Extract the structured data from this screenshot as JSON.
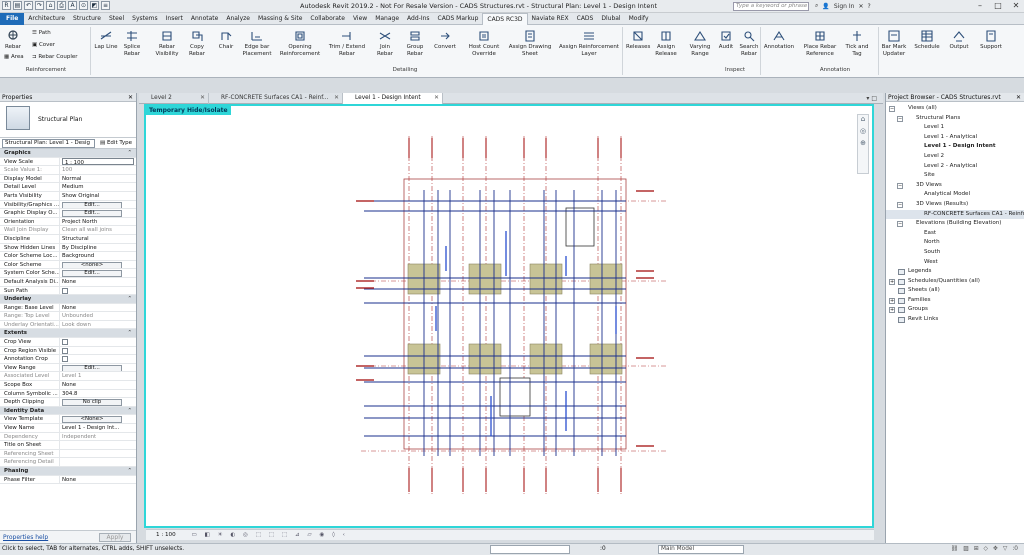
{
  "title_bar": {
    "title": "Autodesk Revit 2019.2 - Not For Resale Version - CADS Structures.rvt - Structural Plan: Level 1 - Design Intent",
    "search_placeholder": "Type a keyword or phrase",
    "sign_in": "Sign In",
    "qat_icons": [
      "R",
      "▤",
      "↶",
      "↷",
      "⌂",
      "⎙",
      "A",
      "⊙",
      "◩",
      "≡"
    ]
  },
  "ribbon_tabs": [
    "File",
    "Architecture",
    "Structure",
    "Steel",
    "Systems",
    "Insert",
    "Annotate",
    "Analyze",
    "Massing & Site",
    "Collaborate",
    "View",
    "Manage",
    "Add-Ins",
    "CADS Markup",
    "CADS RC3D",
    "Naviate REX",
    "CADS",
    "Dlubal",
    "Modify"
  ],
  "active_tab": "CADS RC3D",
  "ribbon": {
    "reinforcement": {
      "panel": "Reinforcement",
      "rebar": "Rebar",
      "area": "Area",
      "path": "Path",
      "cover": "Cover",
      "coupler": "Rebar Coupler"
    },
    "tools": {
      "lap_line": "Lap Line",
      "splice_rebar": "Splice Rebar",
      "rebar_visibility": "Rebar Visibility",
      "copy_rebar": "Copy Rebar",
      "chair": "Chair",
      "edge_bar": "Edge bar Placement",
      "opening": "Opening Reinforcement",
      "trim_extend": "Trim / Extend Rebar",
      "join_rebar": "Join Rebar",
      "group_rebar": "Group Rebar",
      "convert": "Convert",
      "host_count": "Host Count Override",
      "assign_sheet": "Assign Drawing Sheet",
      "assign_layer": "Assign Reinforcement Layer",
      "releases": "Releases",
      "assign_release": "Assign Release",
      "varying_range": "Varying Range",
      "audit": "Audit",
      "search_rebar": "Search Rebar",
      "annotation": "Annotation",
      "place_ref": "Place Rebar Reference",
      "tick_tag": "Tick and Tag",
      "bar_mark": "Bar Mark Updater",
      "schedule": "Schedule",
      "output": "Output",
      "support": "Support"
    },
    "panels": {
      "detailing": "Detailing",
      "inspect": "Inspect",
      "annotation": "Annotation"
    }
  },
  "properties": {
    "header": "Properties",
    "type_name": "Structural Plan",
    "instance_selector": "Structural Plan: Level 1 - Desig",
    "edit_type": "Edit Type",
    "rows": [
      {
        "kind": "sec",
        "k": "Graphics"
      },
      {
        "k": "View Scale",
        "v": "1 : 100",
        "box": true
      },
      {
        "k": "Scale Value    1:",
        "v": "100",
        "grey": true
      },
      {
        "k": "Display Model",
        "v": "Normal"
      },
      {
        "k": "Detail Level",
        "v": "Medium"
      },
      {
        "k": "Parts Visibility",
        "v": "Show Original"
      },
      {
        "k": "Visibility/Graphics ...",
        "v": "Edit...",
        "btn": true
      },
      {
        "k": "Graphic Display O...",
        "v": "Edit...",
        "btn": true
      },
      {
        "k": "Orientation",
        "v": "Project North"
      },
      {
        "k": "Wall Join Display",
        "v": "Clean all wall joins",
        "grey": true
      },
      {
        "k": "Discipline",
        "v": "Structural"
      },
      {
        "k": "Show Hidden Lines",
        "v": "By Discipline"
      },
      {
        "k": "Color Scheme Loc...",
        "v": "Background"
      },
      {
        "k": "Color Scheme",
        "v": "<none>",
        "btn": true
      },
      {
        "k": "System Color Sche...",
        "v": "Edit...",
        "btn": true
      },
      {
        "k": "Default Analysis Di...",
        "v": "None"
      },
      {
        "k": "Sun Path",
        "v": "",
        "cb": true
      },
      {
        "kind": "sec",
        "k": "Underlay"
      },
      {
        "k": "Range: Base Level",
        "v": "None"
      },
      {
        "k": "Range: Top Level",
        "v": "Unbounded",
        "grey": true
      },
      {
        "k": "Underlay Orientati...",
        "v": "Look down",
        "grey": true
      },
      {
        "kind": "sec",
        "k": "Extents"
      },
      {
        "k": "Crop View",
        "v": "",
        "cb": true
      },
      {
        "k": "Crop Region Visible",
        "v": "",
        "cb": true
      },
      {
        "k": "Annotation Crop",
        "v": "",
        "cb": true
      },
      {
        "k": "View Range",
        "v": "Edit...",
        "btn": true
      },
      {
        "k": "Associated Level",
        "v": "Level 1",
        "grey": true
      },
      {
        "k": "Scope Box",
        "v": "None"
      },
      {
        "k": "Column Symbolic ...",
        "v": "304.8"
      },
      {
        "k": "Depth Clipping",
        "v": "No clip",
        "btn": true
      },
      {
        "kind": "sec",
        "k": "Identity Data"
      },
      {
        "k": "View Template",
        "v": "<None>",
        "btn": true
      },
      {
        "k": "View Name",
        "v": "Level 1 - Design Int..."
      },
      {
        "k": "Dependency",
        "v": "Independent",
        "grey": true
      },
      {
        "k": "Title on Sheet",
        "v": ""
      },
      {
        "k": "Referencing Sheet",
        "v": "",
        "grey": true
      },
      {
        "k": "Referencing Detail",
        "v": "",
        "grey": true
      },
      {
        "kind": "sec",
        "k": "Phasing"
      },
      {
        "k": "Phase Filter",
        "v": "None"
      }
    ],
    "help": "Properties help",
    "apply": "Apply"
  },
  "view_tabs": [
    "Level 2",
    "RF-CONCRETE Surfaces CA1 - Reinf...",
    "Level 1 - Design Intent"
  ],
  "canvas": {
    "badge": "Temporary Hide/Isolate"
  },
  "view_control": {
    "scale": "1 : 100"
  },
  "browser": {
    "header": "Project Browser - CADS Structures.rvt",
    "items": [
      {
        "t": "Views (all)",
        "d": 0,
        "ex": "−"
      },
      {
        "t": "Structural Plans",
        "d": 1,
        "ex": "−"
      },
      {
        "t": "Level 1",
        "d": 3
      },
      {
        "t": "Level 1 - Analytical",
        "d": 3
      },
      {
        "t": "Level 1 - Design Intent",
        "d": 3,
        "bold": true
      },
      {
        "t": "Level 2",
        "d": 3
      },
      {
        "t": "Level 2 - Analytical",
        "d": 3
      },
      {
        "t": "Site",
        "d": 3
      },
      {
        "t": "3D Views",
        "d": 1,
        "ex": "−"
      },
      {
        "t": "Analytical Model",
        "d": 3
      },
      {
        "t": "3D Views (Results)",
        "d": 1,
        "ex": "−"
      },
      {
        "t": "RF-CONCRETE Surfaces CA1 - Reinfo",
        "d": 3,
        "sel": true
      },
      {
        "t": "Elevations (Building Elevation)",
        "d": 1,
        "ex": "−"
      },
      {
        "t": "East",
        "d": 3
      },
      {
        "t": "North",
        "d": 3
      },
      {
        "t": "South",
        "d": 3
      },
      {
        "t": "West",
        "d": 3
      },
      {
        "t": "Legends",
        "d": 0,
        "icon": true
      },
      {
        "t": "Schedules/Quantities (all)",
        "d": 0,
        "ex": "+",
        "icon": true
      },
      {
        "t": "Sheets (all)",
        "d": 0,
        "icon": true
      },
      {
        "t": "Families",
        "d": 0,
        "ex": "+",
        "icon": true
      },
      {
        "t": "Groups",
        "d": 0,
        "ex": "+",
        "icon": true
      },
      {
        "t": "Revit Links",
        "d": 0,
        "icon": true
      }
    ]
  },
  "status": {
    "text": "Click to select, TAB for alternates, CTRL adds, SHIFT unselects.",
    "model": "Main Model",
    "zero": ":0"
  },
  "colors": {
    "accent": "#1e6bb8",
    "isolate": "#2fd6d8",
    "rebar": "#1a2f8c",
    "grid": "#b03030",
    "hatch": "#c8c496"
  }
}
